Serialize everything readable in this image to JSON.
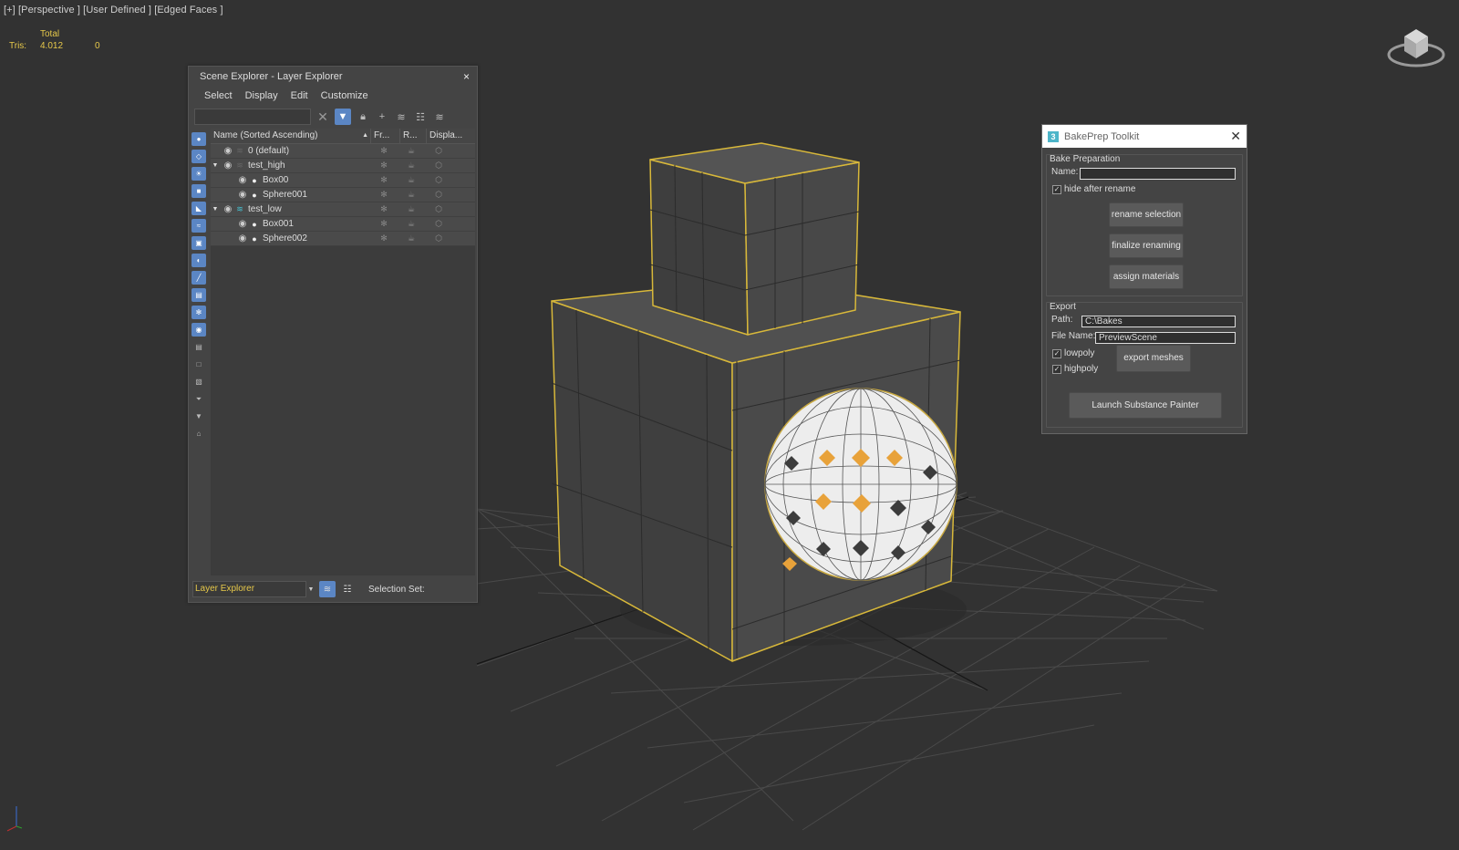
{
  "viewport": {
    "label": "[+] [Perspective ] [User Defined ] [Edged Faces ]",
    "stats": {
      "header": "Total",
      "row_label": "Tris:",
      "total": "4.012",
      "selected": "0"
    }
  },
  "scene_explorer": {
    "title": "Scene Explorer - Layer Explorer",
    "close": "×",
    "menu": [
      "Select",
      "Display",
      "Edit",
      "Customize"
    ],
    "columns": {
      "name": "Name (Sorted Ascending)",
      "freeze": "Fr...",
      "render": "R...",
      "display": "Displa..."
    },
    "rows": [
      {
        "label": "0 (default)",
        "level": 0
      },
      {
        "label": "test_high",
        "level": 0
      },
      {
        "label": "Box00",
        "level": 1
      },
      {
        "label": "Sphere001",
        "level": 1
      },
      {
        "label": "test_low",
        "level": 0
      },
      {
        "label": "Box001",
        "level": 1
      },
      {
        "label": "Sphere002",
        "level": 1
      }
    ],
    "layer_mode": "Layer Explorer",
    "selection_set_label": "Selection Set:"
  },
  "bakeprep": {
    "logo": "3",
    "title": "BakePrep Toolkit",
    "close": "✕",
    "bake_group": "Bake Preparation",
    "name_label": "Name:",
    "name_value": "",
    "hide_after_rename": "hide after rename",
    "rename_selection": "rename selection",
    "finalize_renaming": "finalize renaming",
    "assign_materials": "assign materials",
    "export_group": "Export",
    "path_label": "Path:",
    "path_value": "C:\\Bakes",
    "filename_label": "File Name:",
    "filename_value": "PreviewScene",
    "lowpoly": "lowpoly",
    "highpoly": "highpoly",
    "export_meshes": "export meshes",
    "launch": "Launch Substance Painter"
  },
  "colors": {
    "stats_yellow": "#e6c84a",
    "selection_blue": "#5b86c4",
    "layer_cyan": "#46c3d4",
    "wire_yellow": "#d8b83a",
    "orange_face": "#e8a23a"
  }
}
